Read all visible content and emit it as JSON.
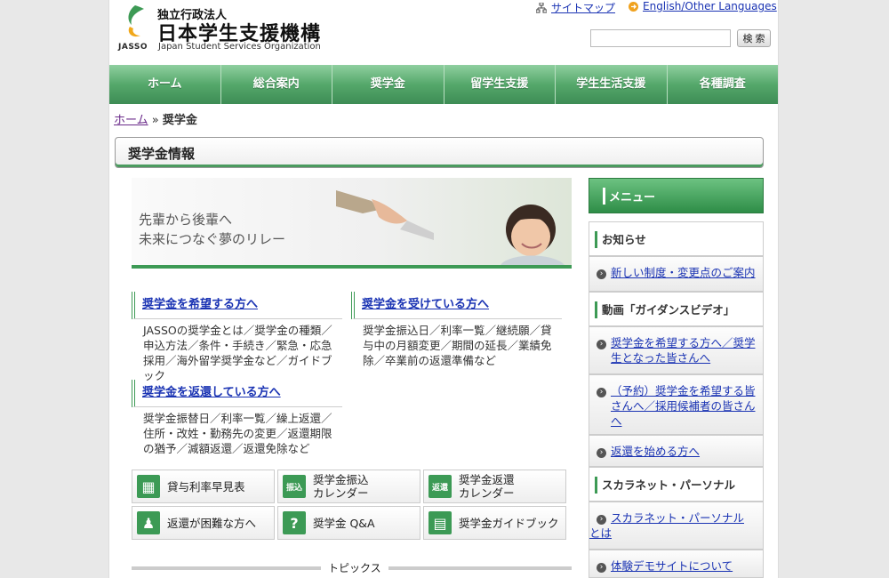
{
  "header": {
    "logo_caption": "JASSO",
    "org_prefix": "独立行政法人",
    "org_name": "日本学生支援機構",
    "org_name_en": "Japan Student Services Organization",
    "sitemap_label": "サイトマップ",
    "english_label": "English/Other Languages",
    "search_placeholder": "",
    "search_button": "検 索"
  },
  "nav": [
    "ホーム",
    "総合案内",
    "奨学金",
    "留学生支援",
    "学生生活支援",
    "各種調査"
  ],
  "breadcrumb": {
    "home": "ホーム",
    "sep": "»",
    "current": "奨学金"
  },
  "page_title": "奨学金情報",
  "banner": {
    "line1": "先輩から後輩へ",
    "line2": "未来につなぐ夢のリレー"
  },
  "blocks": [
    {
      "title": "奨学金を希望する方へ",
      "desc": "JASSOの奨学金とは／奨学金の種類／申込方法／条件・手続き／緊急・応急採用／海外留学奨学金など／ガイドブック"
    },
    {
      "title": "奨学金を受けている方へ",
      "desc": "奨学金振込日／利率一覧／継続願／貸与中の月額変更／期間の延長／業績免除／卒業前の返還準備など"
    },
    {
      "title": "奨学金を返還している方へ",
      "desc": "奨学金振替日／利率一覧／繰上返還／住所・改姓・勤務先の変更／返還期限の猶予／減額返還／返還免除など"
    }
  ],
  "tiles": [
    {
      "icon": "calculator-icon",
      "glyph": "▦",
      "label": "貸与利率早見表"
    },
    {
      "icon": "furikomi-calendar-icon",
      "glyph": "振込",
      "label": "奨学金振込\nカレンダー"
    },
    {
      "icon": "henkan-calendar-icon",
      "glyph": "返還",
      "label": "奨学金返還\nカレンダー"
    },
    {
      "icon": "person-icon",
      "glyph": "♟",
      "label": "返還が困難な方へ"
    },
    {
      "icon": "question-icon",
      "glyph": "?",
      "label": "奨学金 Q&A"
    },
    {
      "icon": "book-icon",
      "glyph": "▤",
      "label": "奨学金ガイドブック"
    }
  ],
  "topics_label": "トピックス",
  "menu": {
    "title": "メニュー",
    "sections": [
      {
        "heading": "お知らせ",
        "links": [
          "新しい制度・変更点のご案内"
        ]
      },
      {
        "heading": "動画「ガイダンスビデオ」",
        "links": [
          "奨学金を希望する方へ／奨学生となった皆さんへ",
          "（予約）奨学金を希望する皆さんへ／採用候補者の皆さんへ",
          "返還を始める方へ"
        ]
      },
      {
        "heading": "スカラネット・パーソナル",
        "links": [
          "スカラネット・パーソナルとは",
          "体験デモサイトについて"
        ]
      }
    ]
  },
  "colors": {
    "accent_green": "#3d9a55",
    "link_blue": "#1a33b3"
  }
}
